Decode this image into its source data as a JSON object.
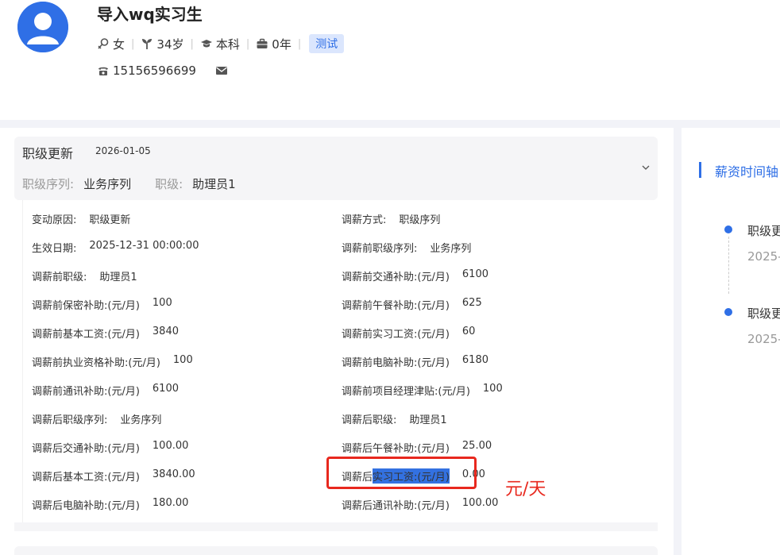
{
  "profile": {
    "name": "导入wq实习生",
    "gender": "女",
    "age": "34岁",
    "education": "本科",
    "experience": "0年",
    "tag": "测试",
    "phone": "15156596699"
  },
  "card": {
    "title": "职级更新",
    "date": "2026-01-05",
    "sequence_label": "职级序列:",
    "sequence_value": "业务序列",
    "level_label": "职级:",
    "level_value": "助理员1"
  },
  "details": {
    "left": [
      {
        "label": "变动原因:",
        "value": "职级更新"
      },
      {
        "label": "生效日期:",
        "value": "2025-12-31 00:00:00"
      },
      {
        "label": "调薪前职级:",
        "value": "助理员1"
      },
      {
        "label": "调薪前保密补助:(元/月)",
        "value": "100"
      },
      {
        "label": "调薪前基本工资:(元/月)",
        "value": "3840"
      },
      {
        "label": "调薪前执业资格补助:(元/月)",
        "value": "100"
      },
      {
        "label": "调薪前通讯补助:(元/月)",
        "value": "6100"
      },
      {
        "label": "调薪后职级序列:",
        "value": "业务序列"
      },
      {
        "label": "调薪后交通补助:(元/月)",
        "value": "100.00"
      },
      {
        "label": "调薪后基本工资:(元/月)",
        "value": "3840.00"
      },
      {
        "label": "调薪后电脑补助:(元/月)",
        "value": "180.00"
      }
    ],
    "right": [
      {
        "label": "调薪方式:",
        "value": "职级序列"
      },
      {
        "label": "调薪前职级序列:",
        "value": "业务序列"
      },
      {
        "label": "调薪前交通补助:(元/月)",
        "value": "6100"
      },
      {
        "label": "调薪前午餐补助:(元/月)",
        "value": "625"
      },
      {
        "label": "调薪前实习工资:(元/月)",
        "value": "60"
      },
      {
        "label": "调薪前电脑补助:(元/月)",
        "value": "6180"
      },
      {
        "label": "调薪前项目经理津贴:(元/月)",
        "value": "100"
      },
      {
        "label": "调薪后职级:",
        "value": "助理员1"
      },
      {
        "label": "调薪后午餐补助:(元/月)",
        "value": "25.00"
      },
      {
        "label_prefix": "调薪后",
        "label_selected": "实习工资:(元/月)",
        "value": "0.00"
      },
      {
        "label": "调薪后通讯补助:(元/月)",
        "value": "100.00"
      }
    ]
  },
  "annotation": "元/天",
  "timeline": {
    "title": "薪资时间轴",
    "items": [
      {
        "label": "职级更",
        "date": "2025-"
      },
      {
        "label": "职级更",
        "date": "2025-"
      }
    ]
  },
  "colors": {
    "accent": "#2f6fe6",
    "annotation_red": "#e8281e",
    "selection": "#3371e1"
  }
}
